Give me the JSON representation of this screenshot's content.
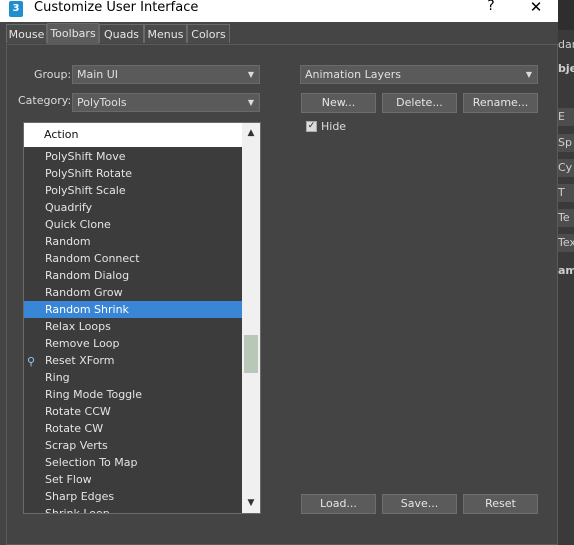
{
  "window": {
    "title": "Customize User Interface",
    "app_icon": "3",
    "help": "?",
    "close": "✕"
  },
  "tabs": [
    "Mouse",
    "Toolbars",
    "Quads",
    "Menus",
    "Colors"
  ],
  "active_tab": "Toolbars",
  "group": {
    "label": "Group:",
    "value": "Main UI"
  },
  "category": {
    "label": "Category:",
    "value": "PolyTools"
  },
  "toolbar_select": {
    "value": "Animation Layers"
  },
  "buttons": {
    "new": "New...",
    "delete": "Delete...",
    "rename": "Rename...",
    "load": "Load...",
    "save": "Save...",
    "reset": "Reset"
  },
  "hide": {
    "label": "Hide",
    "checked": true
  },
  "action_list": {
    "header": "Action",
    "selected": "Random Shrink",
    "items": [
      "PolyShift Move",
      "PolyShift Rotate",
      "PolyShift Scale",
      "Quadrify",
      "Quick Clone",
      "Random",
      "Random Connect",
      "Random Dialog",
      "Random Grow",
      "Random Shrink",
      "Relax Loops",
      "Remove Loop",
      "Reset XForm",
      "Ring",
      "Ring Mode Toggle",
      "Rotate CCW",
      "Rotate CW",
      "Scrap Verts",
      "Selection To Map",
      "Set Flow",
      "Sharp Edges",
      "Shrink Loop"
    ]
  },
  "background_app": {
    "texts": [
      "dar",
      "bje",
      "E",
      "Sp",
      "Cy",
      "T",
      "Te",
      "Tex",
      "am"
    ]
  },
  "colors": {
    "selection": "#3a86d6",
    "panel": "#444444",
    "titlebar": "#ffffff"
  }
}
